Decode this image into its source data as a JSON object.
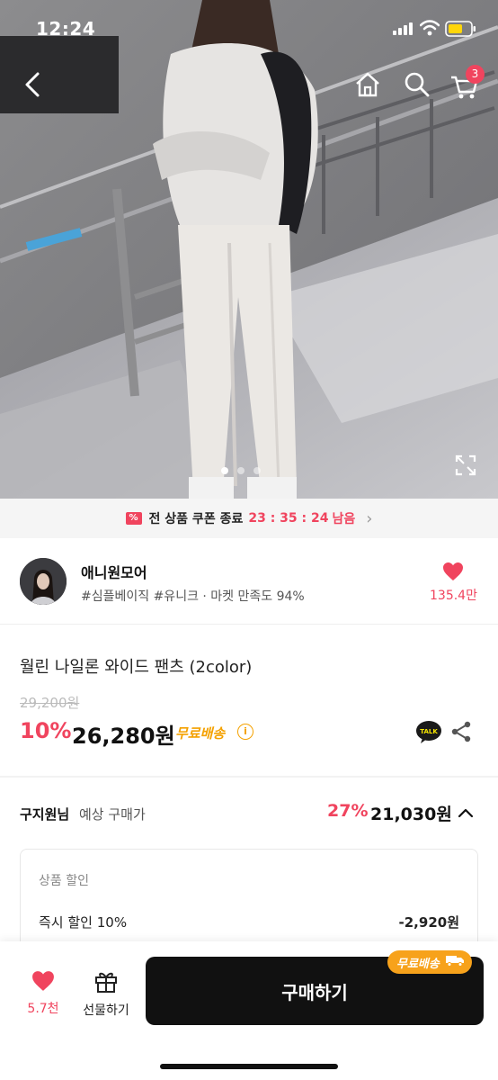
{
  "status_bar": {
    "time": "12:24"
  },
  "header": {
    "cart_badge": "3"
  },
  "gallery": {
    "page_count": 3,
    "active_index": 0
  },
  "coupon": {
    "text": "전 상품 쿠폰 종료",
    "countdown": "23 : 35 : 24",
    "remaining": "남음"
  },
  "shop": {
    "name": "애니원모어",
    "tags": "#심플베이직 #유니크 · 마켓 만족도 94%",
    "like_count": "135.4만"
  },
  "product": {
    "title": "월린 나일론 와이드 팬츠 (2color)",
    "original_price": "29,200원",
    "discount_rate": "10%",
    "sale_price": "26,280원",
    "shipping": "무료배송"
  },
  "expected": {
    "user_name": "구지원님",
    "label": "예상 구매가",
    "rate": "27%",
    "price": "21,030원"
  },
  "discount_box": {
    "title": "상품 할인",
    "items": [
      {
        "label": "즉시 할인 10%",
        "value": "-2,920원"
      }
    ]
  },
  "bottom": {
    "wish_count": "5.7천",
    "gift_label": "선물하기",
    "buy_label": "구매하기",
    "ship_badge": "무료배송"
  },
  "colors": {
    "accent": "#f0445e",
    "shipping": "#f4a100",
    "button": "#111111"
  }
}
